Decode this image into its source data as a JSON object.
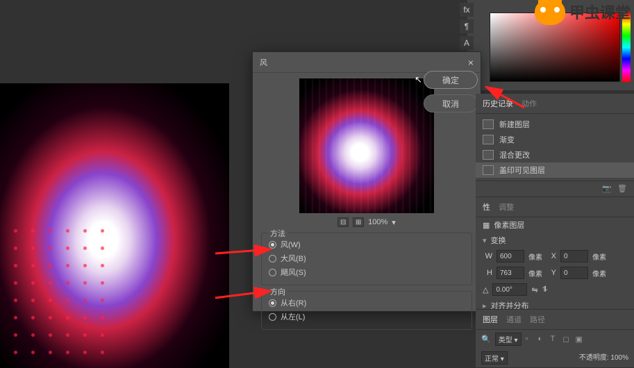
{
  "logo_text": "甲虫课堂",
  "dialog": {
    "title": "风",
    "zoom": "100%",
    "ok": "确定",
    "cancel": "取消",
    "method": {
      "legend": "方法",
      "opt1": "风(W)",
      "opt2": "大风(B)",
      "opt3": "飓风(S)"
    },
    "direction": {
      "legend": "方向",
      "opt1": "从右(R)",
      "opt2": "从左(L)"
    }
  },
  "panels": {
    "history_tab": "历史记录",
    "actions_tab": "动作",
    "history": {
      "item1": "新建图层",
      "item2": "渐变",
      "item3": "混合更改",
      "item4": "盖印可见图层"
    },
    "props_tab": "性",
    "adjust_tab": "调整",
    "pixel_layer": "像素图层",
    "transform": "变换",
    "w_label": "W",
    "w_value": "600",
    "h_label": "H",
    "h_value": "763",
    "x_label": "X",
    "x_value": "0",
    "y_label": "Y",
    "y_value": "0",
    "unit": "像素",
    "angle": "0.00°",
    "align": "对齐并分布",
    "layers_tab": "图层",
    "channels_tab": "通道",
    "paths_tab": "路径",
    "filter_type": "类型",
    "blend_mode": "正常",
    "opacity_label": "不透明度:",
    "opacity_value": "100%"
  }
}
